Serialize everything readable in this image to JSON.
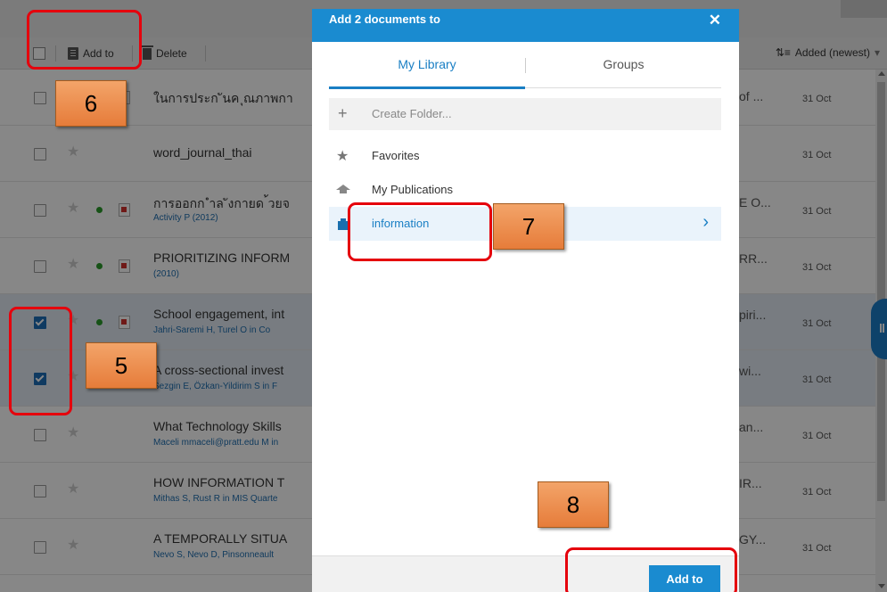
{
  "toolbar": {
    "add_to_label": "Add to",
    "delete_label": "Delete",
    "sort_label": "Added (newest)"
  },
  "documents": [
    {
      "title": "ในการประก ันค ุณภาพกา",
      "subtitle": "",
      "right": "of ...",
      "date": "31 Oct",
      "checked": false,
      "dot": false,
      "pdf": true
    },
    {
      "title": "word_journal_thai",
      "subtitle": "",
      "right": "",
      "date": "31 Oct",
      "checked": false,
      "dot": false,
      "pdf": false
    },
    {
      "title": "การออกก ําล ังกายด ้วยจ",
      "subtitle": "Activity P (2012)",
      "right": "E O...",
      "date": "31 Oct",
      "checked": false,
      "dot": true,
      "pdf": true
    },
    {
      "title": "PRIORITIZING INFORM",
      "subtitle": "(2010)",
      "right": "RR...",
      "date": "31 Oct",
      "checked": false,
      "dot": true,
      "pdf": true
    },
    {
      "title": "School engagement, int",
      "subtitle": "Jahri-Saremi H, Turel O in Co",
      "right": "piri...",
      "date": "31 Oct",
      "checked": true,
      "dot": true,
      "pdf": true
    },
    {
      "title": "A cross-sectional invest",
      "subtitle": "Sezgin E, Özkan-Yildirim S in F",
      "right": "wi...",
      "date": "31 Oct",
      "checked": true,
      "dot": false,
      "pdf": true
    },
    {
      "title": "What Technology Skills",
      "subtitle": "Maceli mmaceli@pratt.edu M in",
      "right": "an...",
      "date": "31 Oct",
      "checked": false,
      "dot": false,
      "pdf": false
    },
    {
      "title": "HOW INFORMATION T",
      "subtitle": "Mithas S, Rust R in MIS Quarte",
      "right": "IR...",
      "date": "31 Oct",
      "checked": false,
      "dot": false,
      "pdf": false
    },
    {
      "title": "A TEMPORALLY SITUA",
      "subtitle": "Nevo S, Nevo D, Pinsonneault",
      "right": "GY...",
      "date": "31 Oct",
      "checked": false,
      "dot": false,
      "pdf": false
    }
  ],
  "modal": {
    "title": "Add 2 documents to",
    "close": "✕",
    "tabs": [
      "My Library",
      "Groups"
    ],
    "create_folder": "Create Folder...",
    "items": [
      "Favorites",
      "My Publications",
      "information"
    ],
    "add_button": "Add to"
  },
  "annotations": [
    "5",
    "6",
    "7",
    "8"
  ],
  "colors": {
    "accent": "#1a8bd0",
    "callout": "#e5000c",
    "badge": "#e67c3a"
  },
  "icons": {
    "star": "star-icon",
    "doc": "document-icon",
    "trash": "trash-icon",
    "sort": "sort-lines-icon"
  }
}
